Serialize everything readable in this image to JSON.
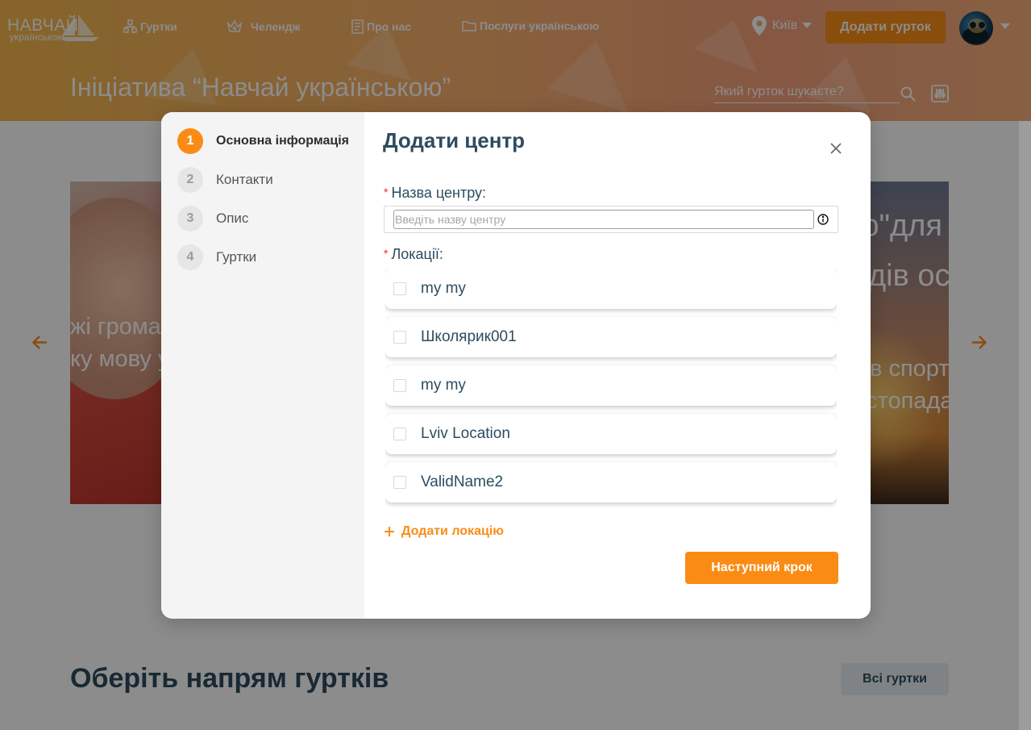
{
  "header": {
    "logo": {
      "line1": "НАВЧАЙ",
      "line2": "українською"
    },
    "nav": [
      {
        "label": "Гуртки",
        "icon": "clubs-icon"
      },
      {
        "label": "Челендж",
        "icon": "challenge-icon"
      },
      {
        "label": "Про нас",
        "icon": "about-icon"
      },
      {
        "label": "Послуги українською",
        "icon": "folder-icon"
      }
    ],
    "city": "Київ",
    "add_club_label": "Додати гурток",
    "page_heading": "Ініціатива “Навчай українською”",
    "search_placeholder": "Який гурток шукаєте?"
  },
  "background": {
    "banner_left_lines": [
      "жі грома",
      "ку мову у"
    ],
    "banner_right_lines": [
      "ю\"для",
      "дів ос",
      "в спорт",
      "стопада"
    ],
    "section_title": "Оберіть напрям гуртків",
    "all_clubs_label": "Всі гуртки"
  },
  "modal": {
    "title": "Додати центр",
    "steps": [
      {
        "num": "1",
        "label": "Основна інформація",
        "active": true
      },
      {
        "num": "2",
        "label": "Контакти",
        "active": false
      },
      {
        "num": "3",
        "label": "Опис",
        "active": false
      },
      {
        "num": "4",
        "label": "Гуртки",
        "active": false
      }
    ],
    "name_field": {
      "label": "Назва центру",
      "colon": ":",
      "placeholder": "Введіть назву центру",
      "value": ""
    },
    "locations_field": {
      "label": "Локації",
      "colon": ":"
    },
    "locations": [
      {
        "label": "my my",
        "checked": false
      },
      {
        "label": "Школярик001",
        "checked": false
      },
      {
        "label": "my my",
        "checked": false
      },
      {
        "label": "Lviv Location",
        "checked": false
      },
      {
        "label": "ValidName2",
        "checked": false
      }
    ],
    "add_location_label": "Додати локацію",
    "next_label": "Наступний крок"
  },
  "colors": {
    "accent": "#fa8c16",
    "heading": "#2d4c5f",
    "required": "#f5222d"
  }
}
